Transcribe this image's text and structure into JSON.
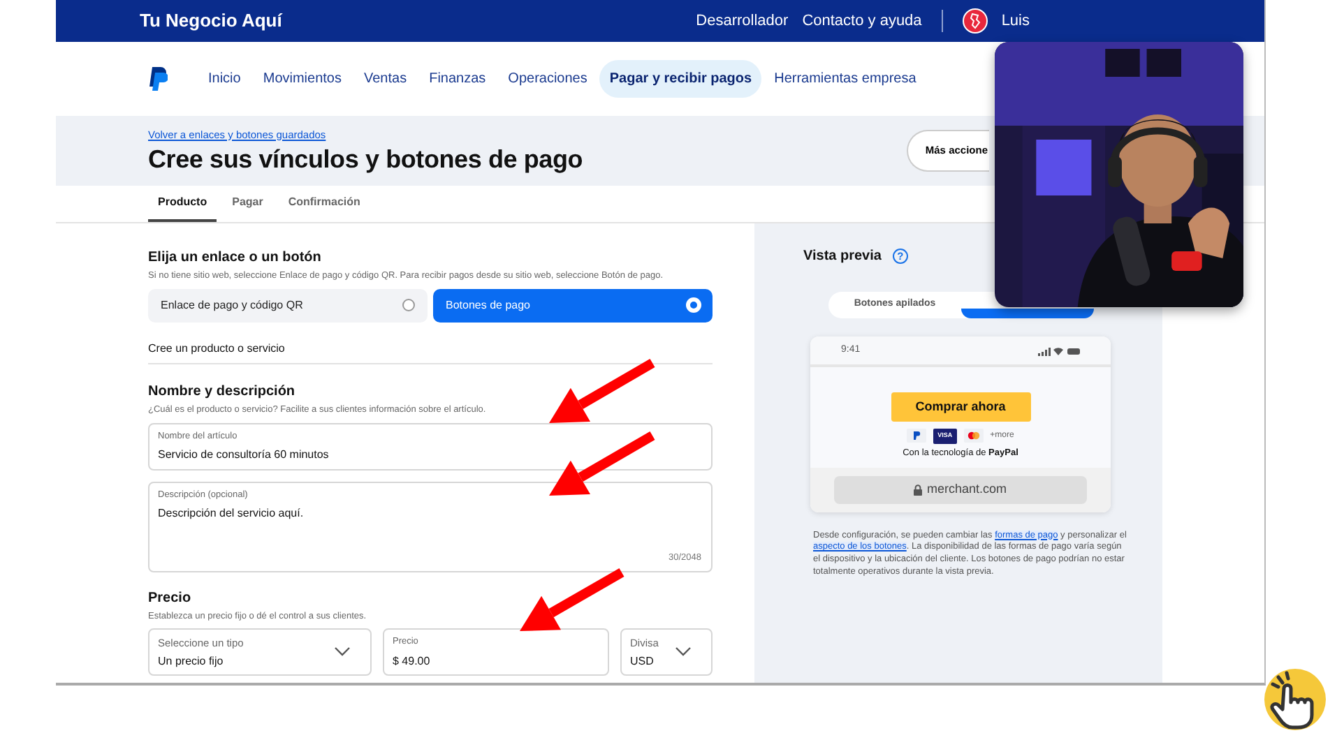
{
  "header": {
    "brand": "Tu Negocio Aquí",
    "links": [
      "Desarrollador",
      "Contacto y ayuda"
    ],
    "user": "Luis"
  },
  "nav": [
    {
      "label": "Inicio",
      "selected": false
    },
    {
      "label": "Movimientos",
      "selected": false
    },
    {
      "label": "Ventas",
      "selected": false
    },
    {
      "label": "Finanzas",
      "selected": false
    },
    {
      "label": "Operaciones",
      "selected": false
    },
    {
      "label": "Pagar y recibir pagos",
      "selected": true
    },
    {
      "label": "Herramientas empresa",
      "selected": false
    }
  ],
  "page": {
    "back_link": "Volver a enlaces y botones guardados",
    "title": "Cree sus vínculos y botones de pago",
    "more_button": "Más accione"
  },
  "steps": [
    {
      "label": "Producto",
      "selected": true
    },
    {
      "label": "Pagar",
      "selected": false
    },
    {
      "label": "Confirmación",
      "selected": false
    }
  ],
  "form": {
    "choose": {
      "heading": "Elija un enlace o un botón",
      "hint": "Si no tiene sitio web, seleccione Enlace de pago y código QR. Para recibir pagos desde su sitio web, seleccione Botón de pago.",
      "options": [
        {
          "label": "Enlace de pago y código QR",
          "selected": false
        },
        {
          "label": "Botones de pago",
          "selected": true
        }
      ]
    },
    "section_label": "Cree un producto o servicio",
    "name_desc": {
      "heading": "Nombre y descripción",
      "hint": "¿Cuál es el producto o servicio? Facilite a sus clientes información sobre el artículo.",
      "name_field": {
        "label": "Nombre del artículo",
        "value": "Servicio de consultoría 60 minutos"
      },
      "desc_field": {
        "label": "Descripción (opcional)",
        "value": "Descripción del servicio aquí.",
        "counter": "30/2048"
      }
    },
    "price": {
      "heading": "Precio",
      "hint": "Establezca un precio fijo o dé el control a sus clientes.",
      "type_select": {
        "label": "Seleccione un tipo",
        "value": "Un precio fijo"
      },
      "price_field": {
        "label": "Precio",
        "value": "$ 49.00"
      },
      "currency_select": {
        "label": "Divisa",
        "value": "USD"
      }
    }
  },
  "preview": {
    "title": "Vista previa",
    "help": "?",
    "layout_tabs": [
      {
        "label": "Botones apilados",
        "selected": false
      },
      {
        "selected": true
      }
    ],
    "phone": {
      "time": "9:41",
      "button": "Comprar ahora",
      "visa": "VISA",
      "more": "+more",
      "powered_by": "Con la tecnología de **PayPal**",
      "url": "merchant.com"
    },
    "note": [
      {
        "text": "Desde configuración, se pueden cambiar las ",
        "link": false
      },
      {
        "text": "formas de pago",
        "link": true
      },
      {
        "text": " y personalizar el ",
        "link": false
      },
      {
        "text": "aspecto de los botones",
        "link": true
      },
      {
        "text": ". La disponibilidad de las formas de pago varía según el dispositivo y la ubicación del cliente. Los botones de pago podrían no estar totalmente operativos durante la vista previa.",
        "link": false
      }
    ]
  }
}
